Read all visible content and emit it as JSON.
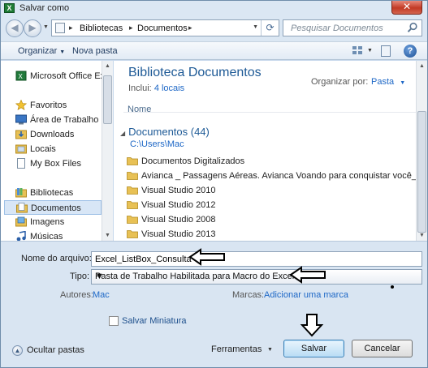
{
  "window": {
    "title": "Salvar como",
    "close_glyph": "✕",
    "app_icon": "excel-icon"
  },
  "address": {
    "segments": [
      "Bibliotecas",
      "Documentos"
    ],
    "search_placeholder": "Pesquisar Documentos"
  },
  "toolbar": {
    "organize_label": "Organizar",
    "new_folder_label": "Nova pasta",
    "help_glyph": "?"
  },
  "navpane": {
    "items": [
      {
        "label": "Microsoft Office Ex",
        "icon": "excel-icon",
        "type": "item"
      },
      {
        "label": "Favoritos",
        "icon": "star-icon",
        "type": "group"
      },
      {
        "label": "Área de Trabalho",
        "icon": "desktop-icon",
        "type": "item"
      },
      {
        "label": "Downloads",
        "icon": "downloads-folder-icon",
        "type": "item"
      },
      {
        "label": "Locais",
        "icon": "recent-places-icon",
        "type": "item"
      },
      {
        "label": "My Box Files",
        "icon": "document-icon",
        "type": "item"
      },
      {
        "label": "Bibliotecas",
        "icon": "libraries-icon",
        "type": "group"
      },
      {
        "label": "Documentos",
        "icon": "documents-library-icon",
        "type": "item",
        "selected": true
      },
      {
        "label": "Imagens",
        "icon": "pictures-library-icon",
        "type": "item"
      },
      {
        "label": "Músicas",
        "icon": "music-library-icon",
        "type": "item"
      }
    ]
  },
  "main": {
    "library_title": "Biblioteca Documentos",
    "includes_prefix": "Inclui:",
    "includes_link": "4 locais",
    "organize_by_label": "Organizar por:",
    "organize_by_value": "Pasta",
    "column_header": "Nome",
    "group_title": "Documentos (44)",
    "group_path": "C:\\Users\\Mac",
    "files": [
      "Documentos Digitalizados",
      "Avianca _ Passagens Aéreas. Avianca Voando para conquistar você_arquivo",
      "Visual Studio 2010",
      "Visual Studio 2012",
      "Visual Studio 2008",
      "Visual Studio 2013"
    ]
  },
  "form": {
    "filename_label": "Nome do arquivo:",
    "filename_value": "Excel_ListBox_Consulta",
    "type_label": "Tipo:",
    "type_value": "Pasta de Trabalho Habilitada para Macro do Excel",
    "authors_label": "Autores:",
    "authors_value": "Mac",
    "tags_label": "Marcas:",
    "tags_value": "Adicionar uma marca",
    "thumbnail_label": "Salvar Miniatura",
    "thumbnail_checked": false
  },
  "footer": {
    "hide_folders_label": "Ocultar pastas",
    "tools_label": "Ferramentas",
    "save_label": "Salvar",
    "cancel_label": "Cancelar"
  },
  "colors": {
    "accent": "#1e5a96",
    "link": "#1d67c6",
    "frame": "#c8d9ec"
  }
}
